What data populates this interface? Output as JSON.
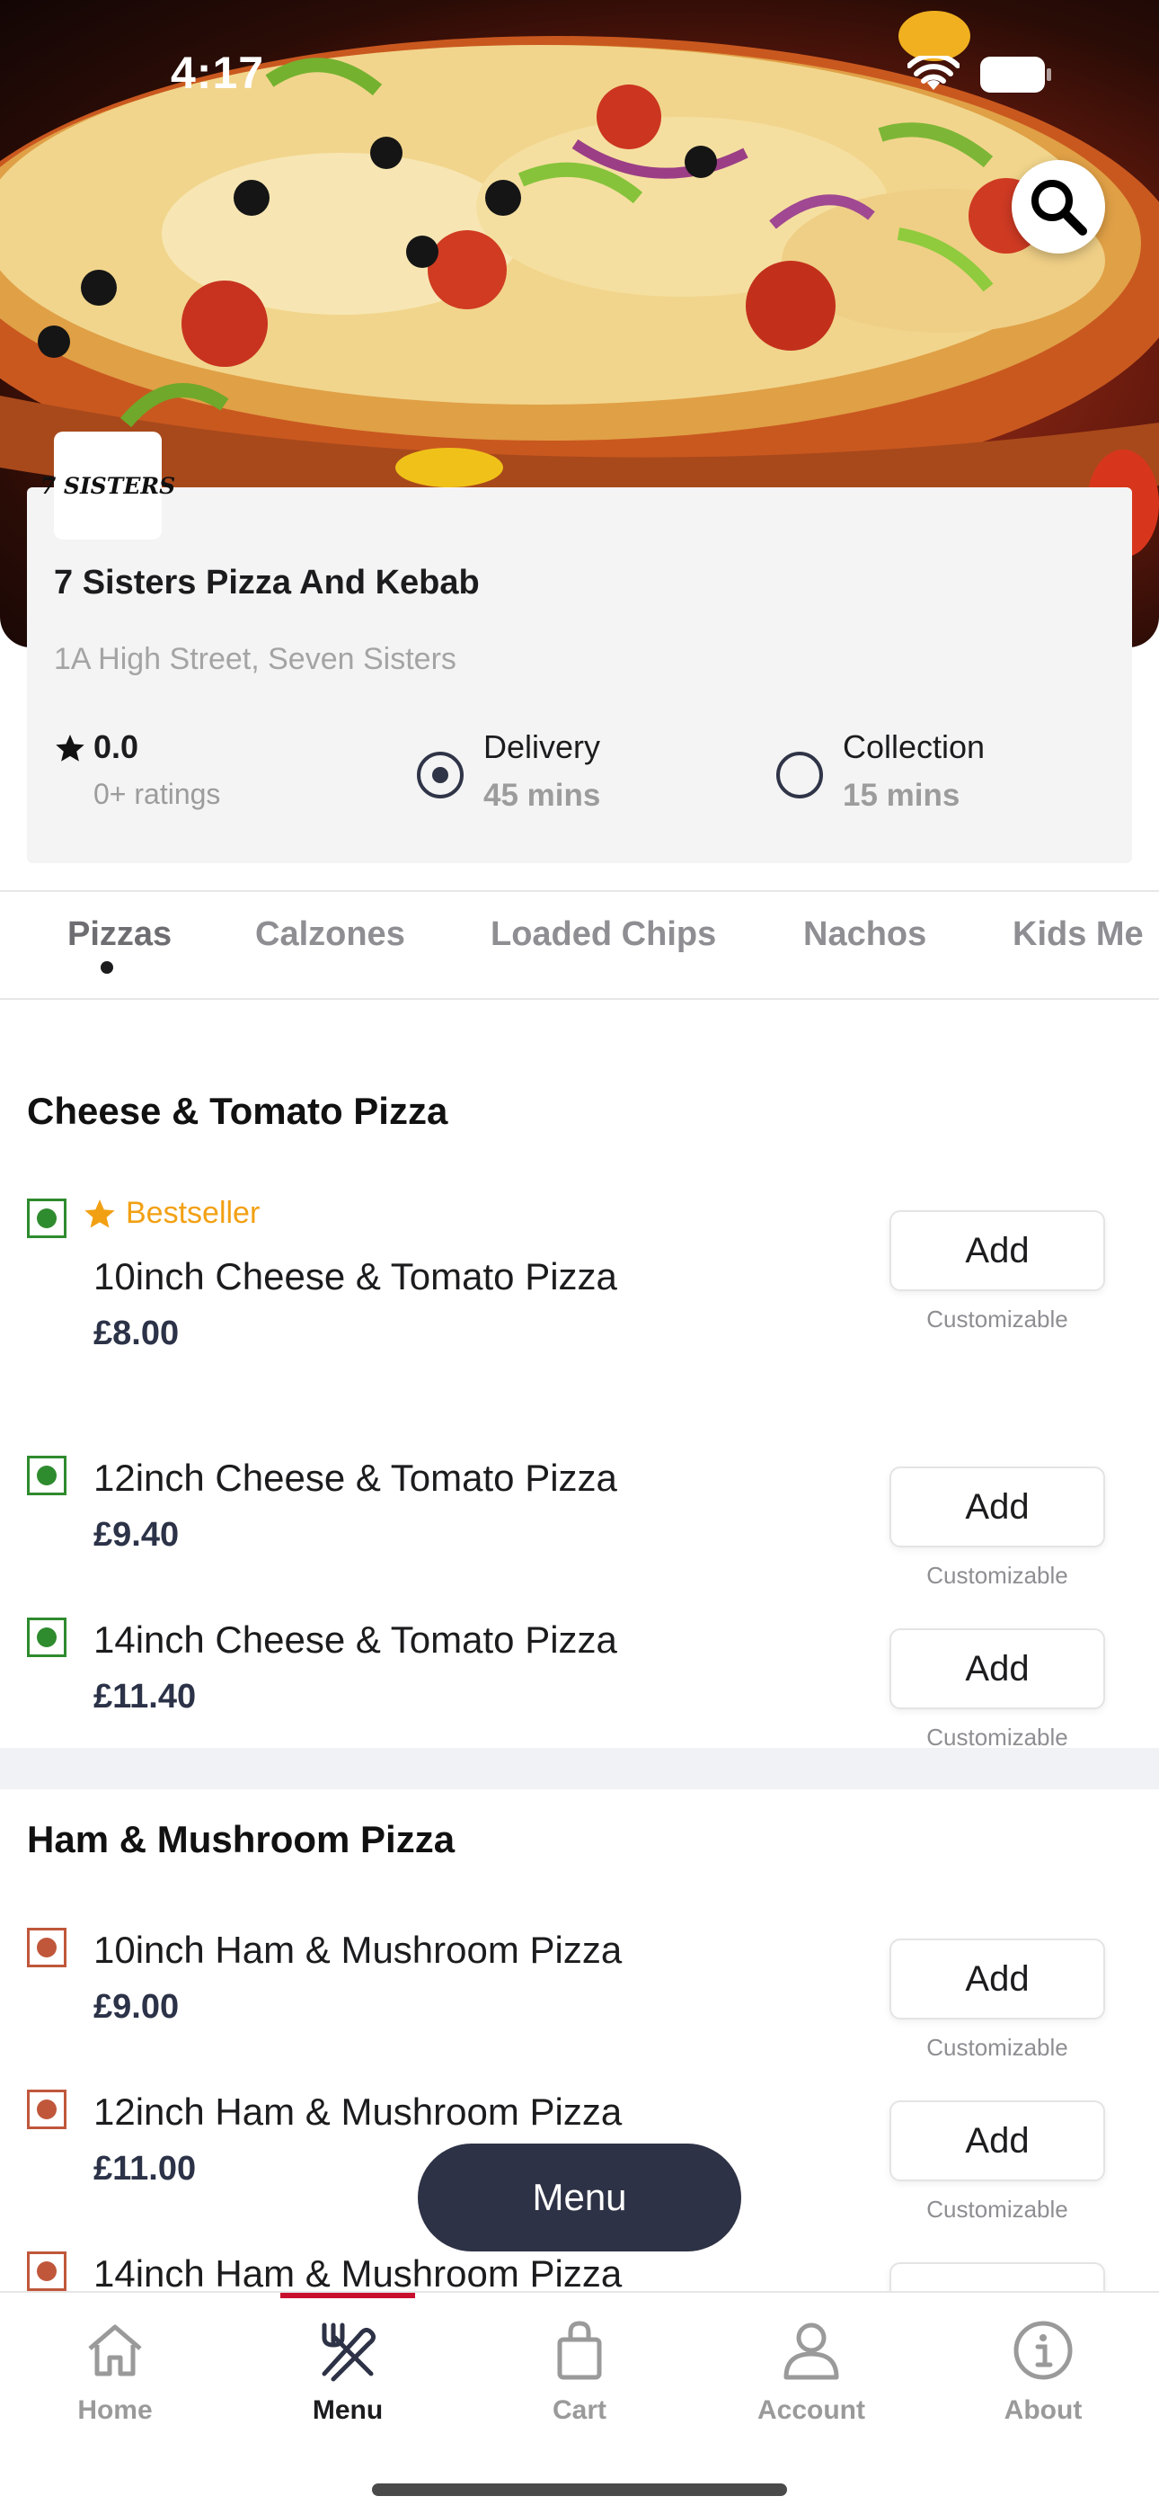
{
  "status_bar": {
    "time": "4:17"
  },
  "restaurant": {
    "logo_text": "7 SISTERS",
    "name": "7 Sisters Pizza And Kebab",
    "address": "1A High Street, Seven Sisters",
    "rating_value": "0.0",
    "rating_count": "0+ ratings",
    "delivery_label": "Delivery",
    "delivery_time": "45 mins",
    "collection_label": "Collection",
    "collection_time": "15 mins",
    "selected_mode": "Delivery"
  },
  "categories": [
    "Pizzas",
    "Calzones",
    "Loaded Chips",
    "Nachos",
    "Kids Me"
  ],
  "active_category": "Pizzas",
  "sections": [
    {
      "title": "Cheese & Tomato Pizza",
      "items": [
        {
          "badge": "Bestseller",
          "name": "10inch Cheese & Tomato Pizza",
          "price": "£8.00",
          "button": "Add",
          "note": "Customizable",
          "diet": "veg"
        },
        {
          "name": "12inch Cheese & Tomato Pizza",
          "price": "£9.40",
          "button": "Add",
          "note": "Customizable",
          "diet": "veg"
        },
        {
          "name": "14inch Cheese & Tomato Pizza",
          "price": "£11.40",
          "button": "Add",
          "note": "Customizable",
          "diet": "veg"
        }
      ]
    },
    {
      "title": "Ham & Mushroom Pizza",
      "items": [
        {
          "name": "10inch Ham & Mushroom Pizza",
          "price": "£9.00",
          "button": "Add",
          "note": "Customizable",
          "diet": "non-veg"
        },
        {
          "name": "12inch Ham & Mushroom Pizza",
          "price": "£11.00",
          "button": "Add",
          "note": "Customizable",
          "diet": "non-veg"
        },
        {
          "name": "14inch Ham & Mushroom Pizza",
          "diet": "non-veg"
        }
      ]
    }
  ],
  "floating_menu_label": "Menu",
  "tabbar": {
    "items": [
      {
        "label": "Home",
        "icon": "home-icon"
      },
      {
        "label": "Menu",
        "icon": "fork-knife-icon"
      },
      {
        "label": "Cart",
        "icon": "shopping-bag-icon"
      },
      {
        "label": "Account",
        "icon": "person-icon"
      },
      {
        "label": "About",
        "icon": "info-icon"
      }
    ],
    "active": "Menu"
  },
  "colors": {
    "accent_dark": "#2e3246",
    "veg_green": "#2e8b2e",
    "nonveg_brown": "#c0573b",
    "bestseller_orange": "#f2a013",
    "active_tab_indicator": "#c8102e"
  }
}
